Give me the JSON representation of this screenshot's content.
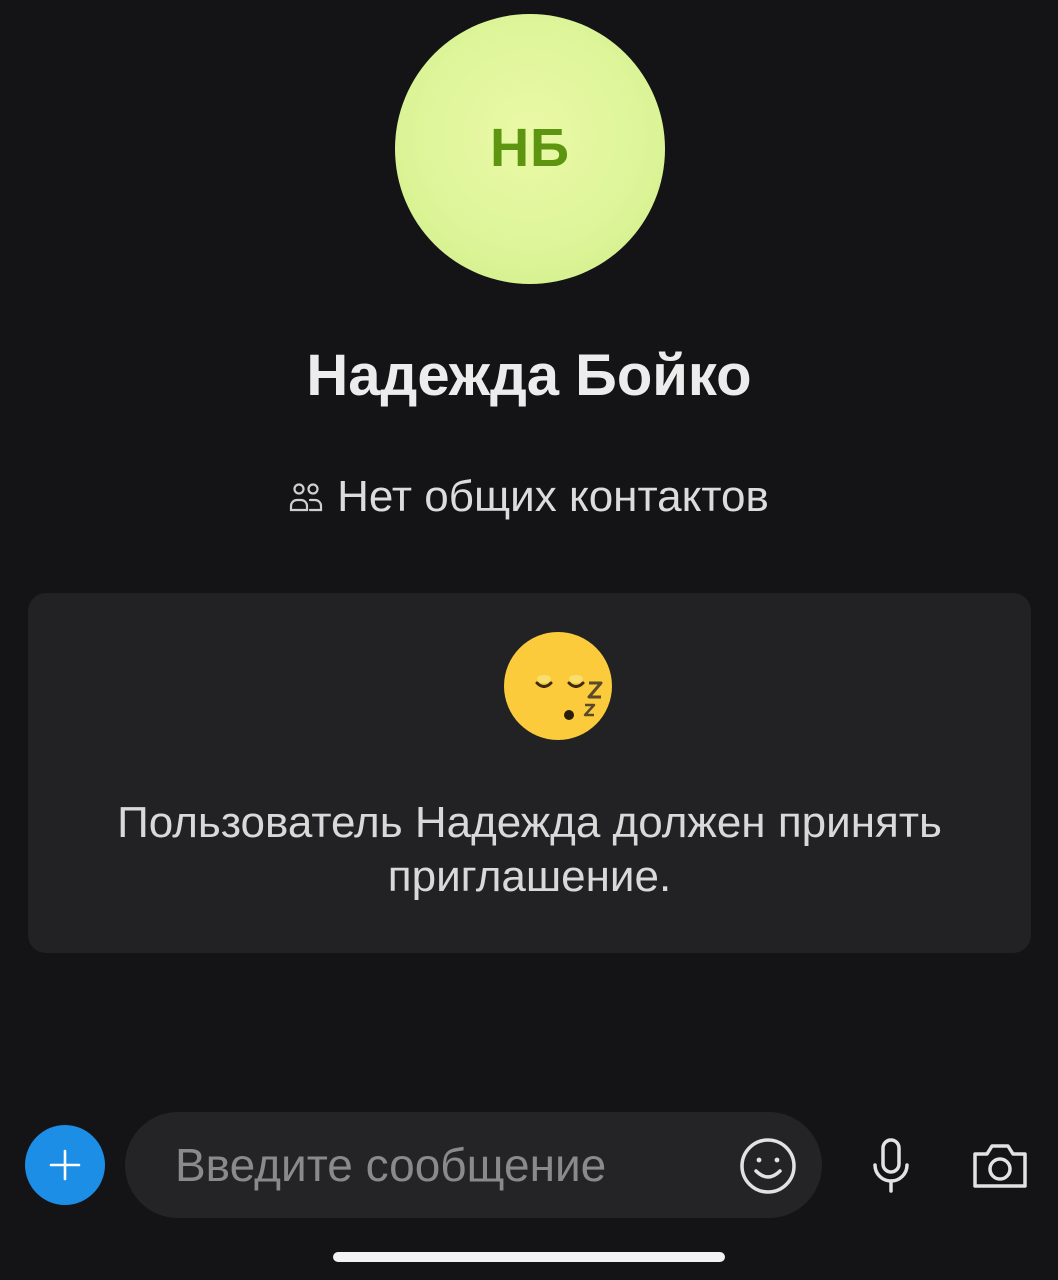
{
  "contact": {
    "initials": "НБ",
    "name": "Надежда Бойко",
    "mutual_contacts": "Нет общих контактов",
    "avatar_color": "#def59a",
    "initials_color": "#5d9511"
  },
  "notice": {
    "emoji_icon": "sleeping-face-icon",
    "text": "Пользователь Надежда должен принять приглашение."
  },
  "composer": {
    "placeholder": "Введите сообщение",
    "add_icon": "plus-icon",
    "emoji_icon": "smiley-icon",
    "mic_icon": "microphone-icon",
    "camera_icon": "camera-icon",
    "accent_color": "#1c8ee6"
  }
}
